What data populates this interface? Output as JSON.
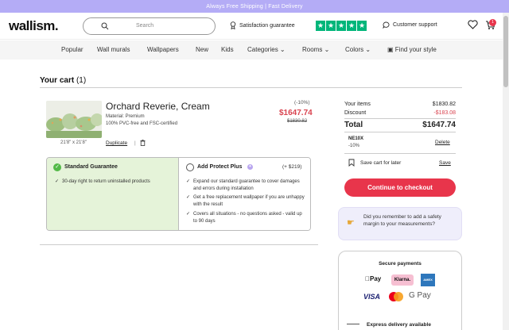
{
  "promo": {
    "text": "Always Free Shipping | Fast Delivery"
  },
  "header": {
    "logo": "wallism.",
    "search_placeholder": "Search",
    "satisfaction": "Satisfaction guarantee",
    "support": "Customer support",
    "cart_count": "1",
    "trustpilot_stars": 5
  },
  "nav": {
    "items": [
      "Popular",
      "Wall murals",
      "Wallpapers",
      "New",
      "Kids",
      "Categories",
      "Rooms",
      "Colors",
      "Find your style"
    ]
  },
  "cart": {
    "title": "Your cart",
    "count": "(1)",
    "item": {
      "name": "Orchard Reverie, Cream",
      "material": "Material: Premium",
      "certification": "100% PVC-free and FSC-certified",
      "dimensions": "21'8\" x 21'8\"",
      "discount": "(-10%)",
      "price": "$1647.74",
      "old_price": "$1830.82",
      "duplicate": "Duplicate",
      "separator": "|"
    },
    "protection": {
      "standard": {
        "title": "Standard Guarantee",
        "bullets": [
          "30-day right to return uninstalled products"
        ]
      },
      "plus": {
        "title": "Add Protect Plus",
        "price": "(+ $219)",
        "bullets": [
          "Expand our standard guarantee to cover damages and errors during installation",
          "Get a free replacement wallpaper if you are unhappy with the result",
          "Covers all situations - no questions asked - valid up to 90 days"
        ]
      }
    }
  },
  "summary": {
    "your_items_label": "Your items",
    "your_items_value": "$1830.82",
    "discount_label": "Discount",
    "discount_value": "-$183.08",
    "total_label": "Total",
    "total_value": "$1647.74",
    "code": "NE10X",
    "code_pct": "-10%",
    "delete": "Delete",
    "save_later": "Save cart for later",
    "save": "Save",
    "checkout": "Continue to checkout"
  },
  "tip": {
    "text": "Did you remember to add a safety margin to your measurements?"
  },
  "payments": {
    "title": "Secure payments",
    "methods": [
      "Pay",
      "Klarna.",
      "AMEX",
      "VISA",
      "G Pay"
    ]
  },
  "delivery": {
    "text": "Express delivery available"
  },
  "colors": {
    "accent": "#e8354b",
    "promo": "#b4acf6",
    "trustpilot": "#00b67a",
    "guarantee_bg": "#e5f3d9"
  }
}
